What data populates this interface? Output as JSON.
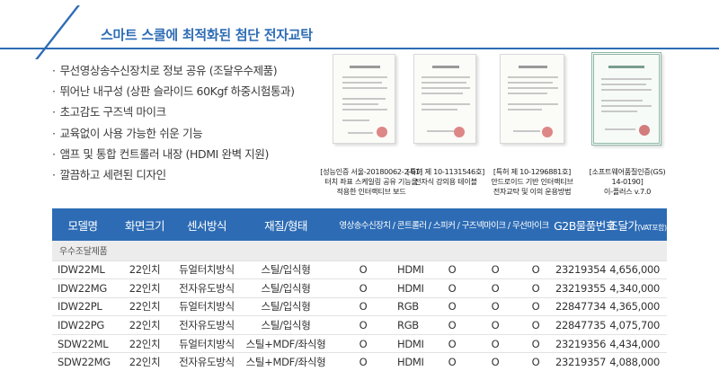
{
  "header": {
    "title": "스마트 스쿨에 최적화된 첨단 전자교탁"
  },
  "features": [
    "무선영상송수신장치로 정보 공유 (조달우수제품)",
    "뛰어난 내구성 (상판 슬라이드 60Kgf 하중시험통과)",
    "초고감도 구즈넥 마이크",
    "교육없이 사용 가능한 쉬운 기능",
    "앰프 및 통합 컨트롤러 내장 (HDMI 완벽 지원)",
    "깔끔하고 세련된 디자인"
  ],
  "certs": [
    {
      "lines": [
        "[성능인증 서울-20180062-2-01]",
        "터치 좌표 스케일링 공유 기능을",
        "적용한 인터랙티브 보드"
      ]
    },
    {
      "lines": [
        "[특허 제 10-1131546호]",
        "전자식 강의용 테이블"
      ]
    },
    {
      "lines": [
        "[특허 제 10-1296881호]",
        "안드로이드 기반 인터랙티브",
        "전자교탁 및 이의 운용방법"
      ]
    },
    {
      "lines": [
        "[소프트웨어품질인증(GS)",
        "14-0190]",
        "이-플러스 v.7.0"
      ]
    }
  ],
  "table": {
    "headers": {
      "model": "모델명",
      "screen": "화면크기",
      "sensor": "센서방식",
      "material": "재질/형태",
      "features": "영상송수신장치 / 콘트롤러 / 스피커 / 구즈넥마이크 / 무선마이크",
      "g2b": "G2B물품번호",
      "price": "조달가",
      "price_note": "(VAT포함)"
    },
    "group_label": "우수조달제품",
    "rows": [
      {
        "model": "IDW22ML",
        "screen": "22인치",
        "sensor": "듀얼터치방식",
        "material": "스틸/입식형",
        "av": "O",
        "ctrl": "HDMI",
        "spk": "O",
        "goose": "O",
        "wmic": "O",
        "g2b": "23219354",
        "price": "4,656,000"
      },
      {
        "model": "IDW22MG",
        "screen": "22인치",
        "sensor": "전자유도방식",
        "material": "스틸/입식형",
        "av": "O",
        "ctrl": "HDMI",
        "spk": "O",
        "goose": "O",
        "wmic": "O",
        "g2b": "23219355",
        "price": "4,340,000"
      },
      {
        "model": "IDW22PL",
        "screen": "22인치",
        "sensor": "듀얼터치방식",
        "material": "스틸/입식형",
        "av": "O",
        "ctrl": "RGB",
        "spk": "O",
        "goose": "O",
        "wmic": "O",
        "g2b": "22847734",
        "price": "4,365,000"
      },
      {
        "model": "IDW22PG",
        "screen": "22인치",
        "sensor": "전자유도방식",
        "material": "스틸/입식형",
        "av": "O",
        "ctrl": "RGB",
        "spk": "O",
        "goose": "O",
        "wmic": "O",
        "g2b": "22847735",
        "price": "4,075,700"
      },
      {
        "model": "SDW22ML",
        "screen": "22인치",
        "sensor": "듀얼터치방식",
        "material": "스틸+MDF/좌식형",
        "av": "O",
        "ctrl": "HDMI",
        "spk": "O",
        "goose": "O",
        "wmic": "O",
        "g2b": "23219356",
        "price": "4,434,000"
      },
      {
        "model": "SDW22MG",
        "screen": "22인치",
        "sensor": "전자유도방식",
        "material": "스틸+MDF/좌식형",
        "av": "O",
        "ctrl": "HDMI",
        "spk": "O",
        "goose": "O",
        "wmic": "O",
        "g2b": "23219357",
        "price": "4,088,000"
      }
    ]
  },
  "colors": {
    "accent": "#2d6cb5",
    "group_bg": "#ececec"
  }
}
